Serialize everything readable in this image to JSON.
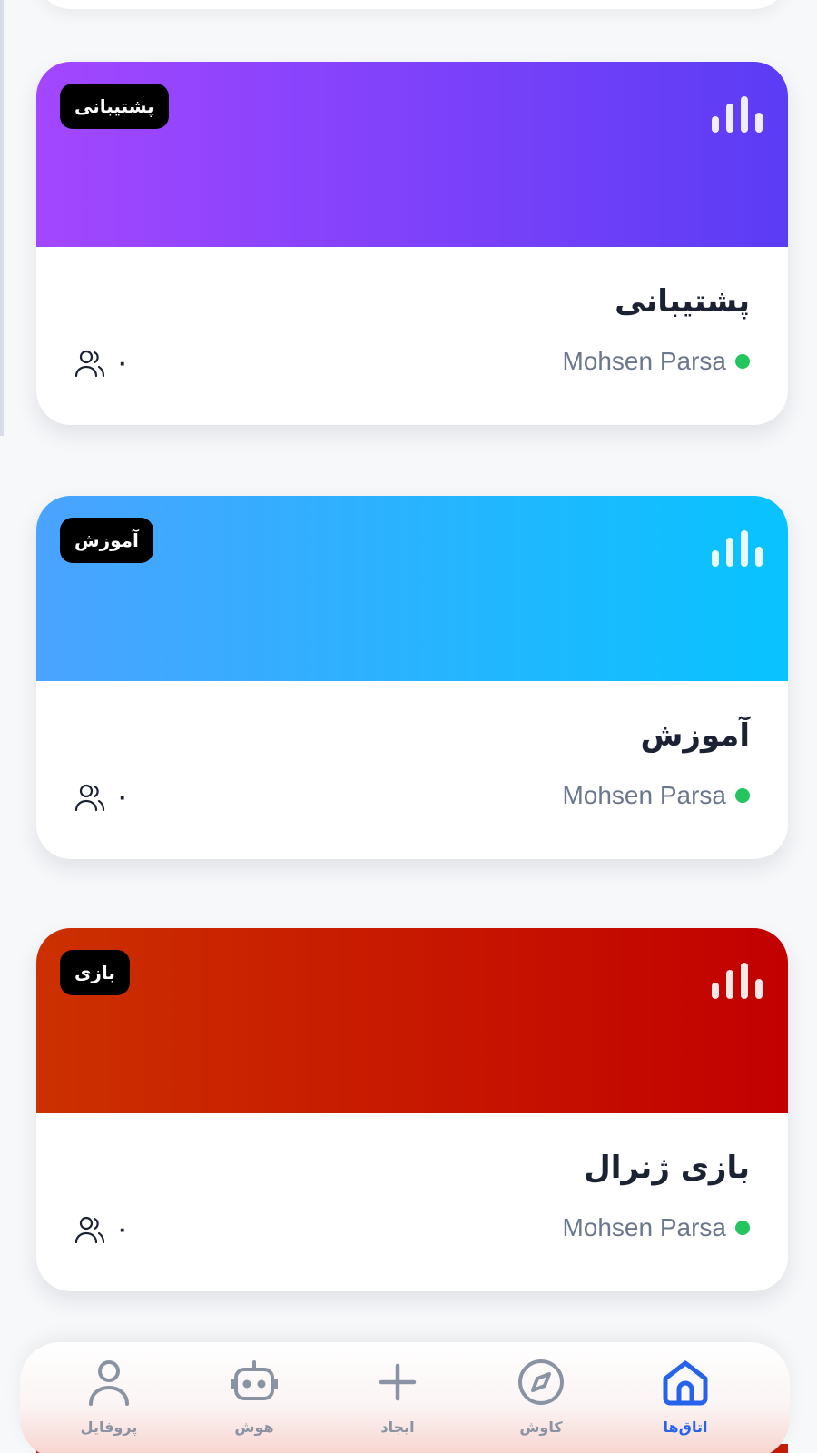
{
  "rooms": [
    {
      "badge": "پشتیبانی",
      "title": "پشتیبانی",
      "owner": "Mohsen Parsa",
      "members": "۰",
      "gradient_from": "#a347ff",
      "gradient_to": "#5b3cf5"
    },
    {
      "badge": "آموزش",
      "title": "آموزش",
      "owner": "Mohsen Parsa",
      "members": "۰",
      "gradient_from": "#4aa3ff",
      "gradient_to": "#08c3ff"
    },
    {
      "badge": "بازی",
      "title": "بازی ژنرال",
      "owner": "Mohsen Parsa",
      "members": "۰",
      "gradient_from": "#cc3000",
      "gradient_to": "#c20000"
    }
  ],
  "nav": {
    "profile": "پروفایل",
    "ai": "هوش",
    "create": "ایجاد",
    "explore": "کاوش",
    "rooms": "اتاق‌ها"
  },
  "colors": {
    "accent": "#2563eb",
    "online": "#22c55e",
    "inactive": "#8a93a3"
  }
}
